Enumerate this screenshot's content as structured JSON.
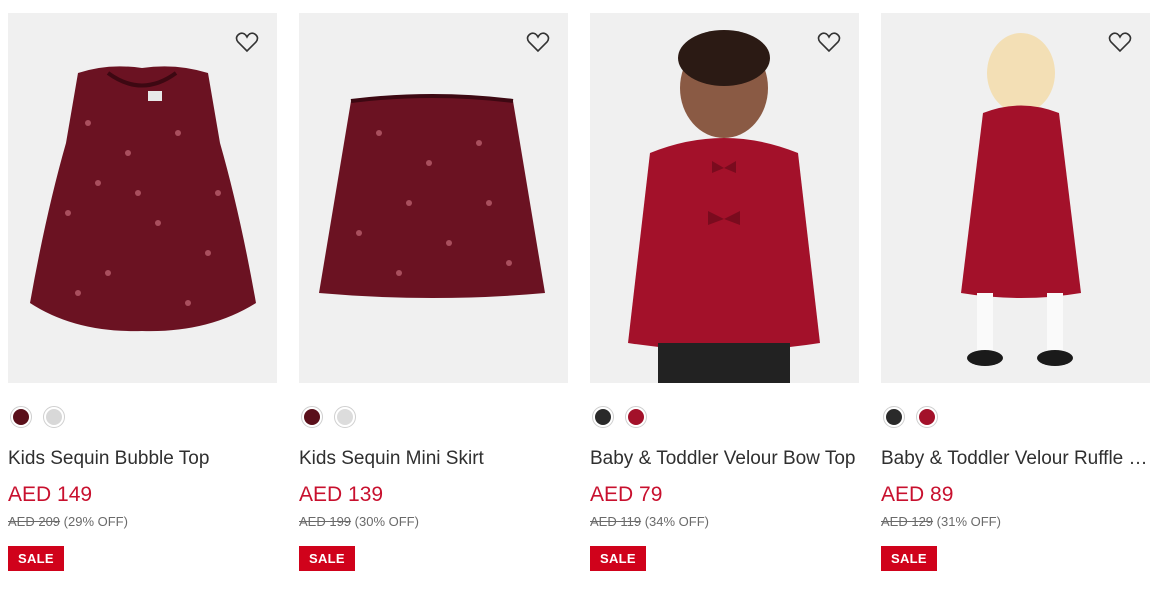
{
  "products": [
    {
      "name": "Kids Sequin Bubble Top",
      "price": "AED 149",
      "was": "AED 209",
      "discount": "(29% OFF)",
      "badge": "SALE",
      "swatches": [
        "#5a0f1a",
        "#d8d8d8"
      ],
      "wishlist_icon": "heart-outline-icon"
    },
    {
      "name": "Kids Sequin Mini Skirt",
      "price": "AED 139",
      "was": "AED 199",
      "discount": "(30% OFF)",
      "badge": "SALE",
      "swatches": [
        "#5a0f1a",
        "#dcdcdc"
      ],
      "wishlist_icon": "heart-outline-icon"
    },
    {
      "name": "Baby & Toddler Velour Bow Top",
      "price": "AED 79",
      "was": "AED 119",
      "discount": "(34% OFF)",
      "badge": "SALE",
      "swatches": [
        "#2a2a2a",
        "#a3112a"
      ],
      "wishlist_icon": "heart-outline-icon"
    },
    {
      "name": "Baby & Toddler Velour Ruffle C...",
      "price": "AED 89",
      "was": "AED 129",
      "discount": "(31% OFF)",
      "badge": "SALE",
      "swatches": [
        "#2a2a2a",
        "#a3112a"
      ],
      "wishlist_icon": "heart-outline-icon"
    }
  ],
  "colors": {
    "sale_red": "#d0021b",
    "price_red": "#c8102e",
    "image_bg": "#f2f2f2"
  }
}
